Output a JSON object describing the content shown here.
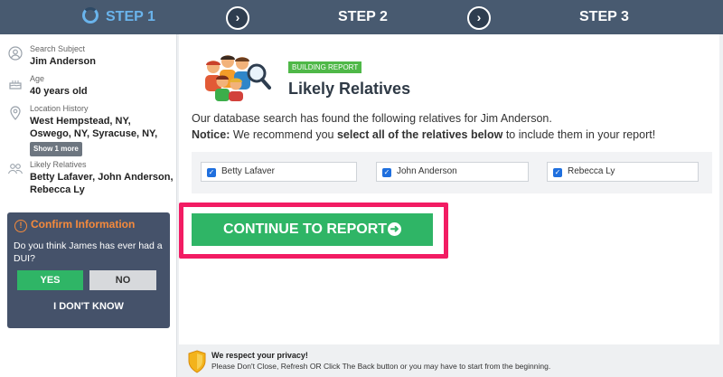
{
  "steps": {
    "step1": "STEP 1",
    "step2": "STEP 2",
    "step3": "STEP 3"
  },
  "sidebar": {
    "subject_label": "Search Subject",
    "subject_value": "Jim Anderson",
    "age_label": "Age",
    "age_value": "40 years old",
    "location_label": "Location History",
    "location_line1": "West Hempstead, NY,",
    "location_line2": "Oswego, NY, Syracuse, NY,",
    "show_more": "Show 1 more",
    "relatives_label": "Likely Relatives",
    "relatives_line1": "Betty Lafaver, John Anderson,",
    "relatives_line2": "Rebecca Ly"
  },
  "confirm": {
    "title": "Confirm Information",
    "question": "Do you think James has ever had a DUI?",
    "yes": "YES",
    "no": "NO",
    "idk": "I DON'T KNOW"
  },
  "main": {
    "badge": "BUILDING REPORT",
    "heading": "Likely Relatives",
    "desc1": "Our database search has found the following relatives for Jim Anderson.",
    "notice_label": "Notice:",
    "notice_pre": " We recommend you ",
    "notice_bold": "select all of the relatives below",
    "notice_post": " to include them in your report!",
    "relatives": [
      "Betty Lafaver",
      "John Anderson",
      "Rebecca Ly"
    ],
    "continue_button": "CONTINUE TO REPORT"
  },
  "footer": {
    "privacy_title": "We respect your privacy!",
    "privacy_text": "Please Don't Close, Refresh OR Click The Back button or you may have to start from the beginning."
  },
  "colors": {
    "step_bar": "#485a70",
    "green": "#2fb566",
    "highlight": "#f21c63",
    "orange": "#f58a3c"
  }
}
